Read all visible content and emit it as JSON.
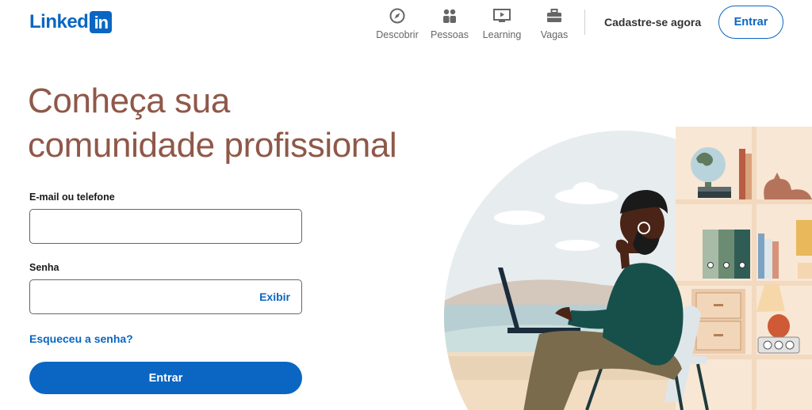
{
  "header": {
    "logo_word": "Linked",
    "logo_box": "in",
    "nav": [
      {
        "label": "Descobrir",
        "icon": "compass-icon"
      },
      {
        "label": "Pessoas",
        "icon": "people-icon"
      },
      {
        "label": "Learning",
        "icon": "play-video-icon"
      },
      {
        "label": "Vagas",
        "icon": "briefcase-icon"
      }
    ],
    "join_label": "Cadastre-se agora",
    "signin_label": "Entrar"
  },
  "hero": {
    "headline_line1": "Conheça sua",
    "headline_line2": "comunidade profissional"
  },
  "form": {
    "email_label": "E-mail ou telefone",
    "email_value": "",
    "password_label": "Senha",
    "password_value": "",
    "show_label": "Exibir",
    "forgot_label": "Esqueceu a senha?",
    "submit_label": "Entrar"
  },
  "colors": {
    "brand": "#0a66c2",
    "headline": "#8f5849",
    "muted": "#666666"
  }
}
